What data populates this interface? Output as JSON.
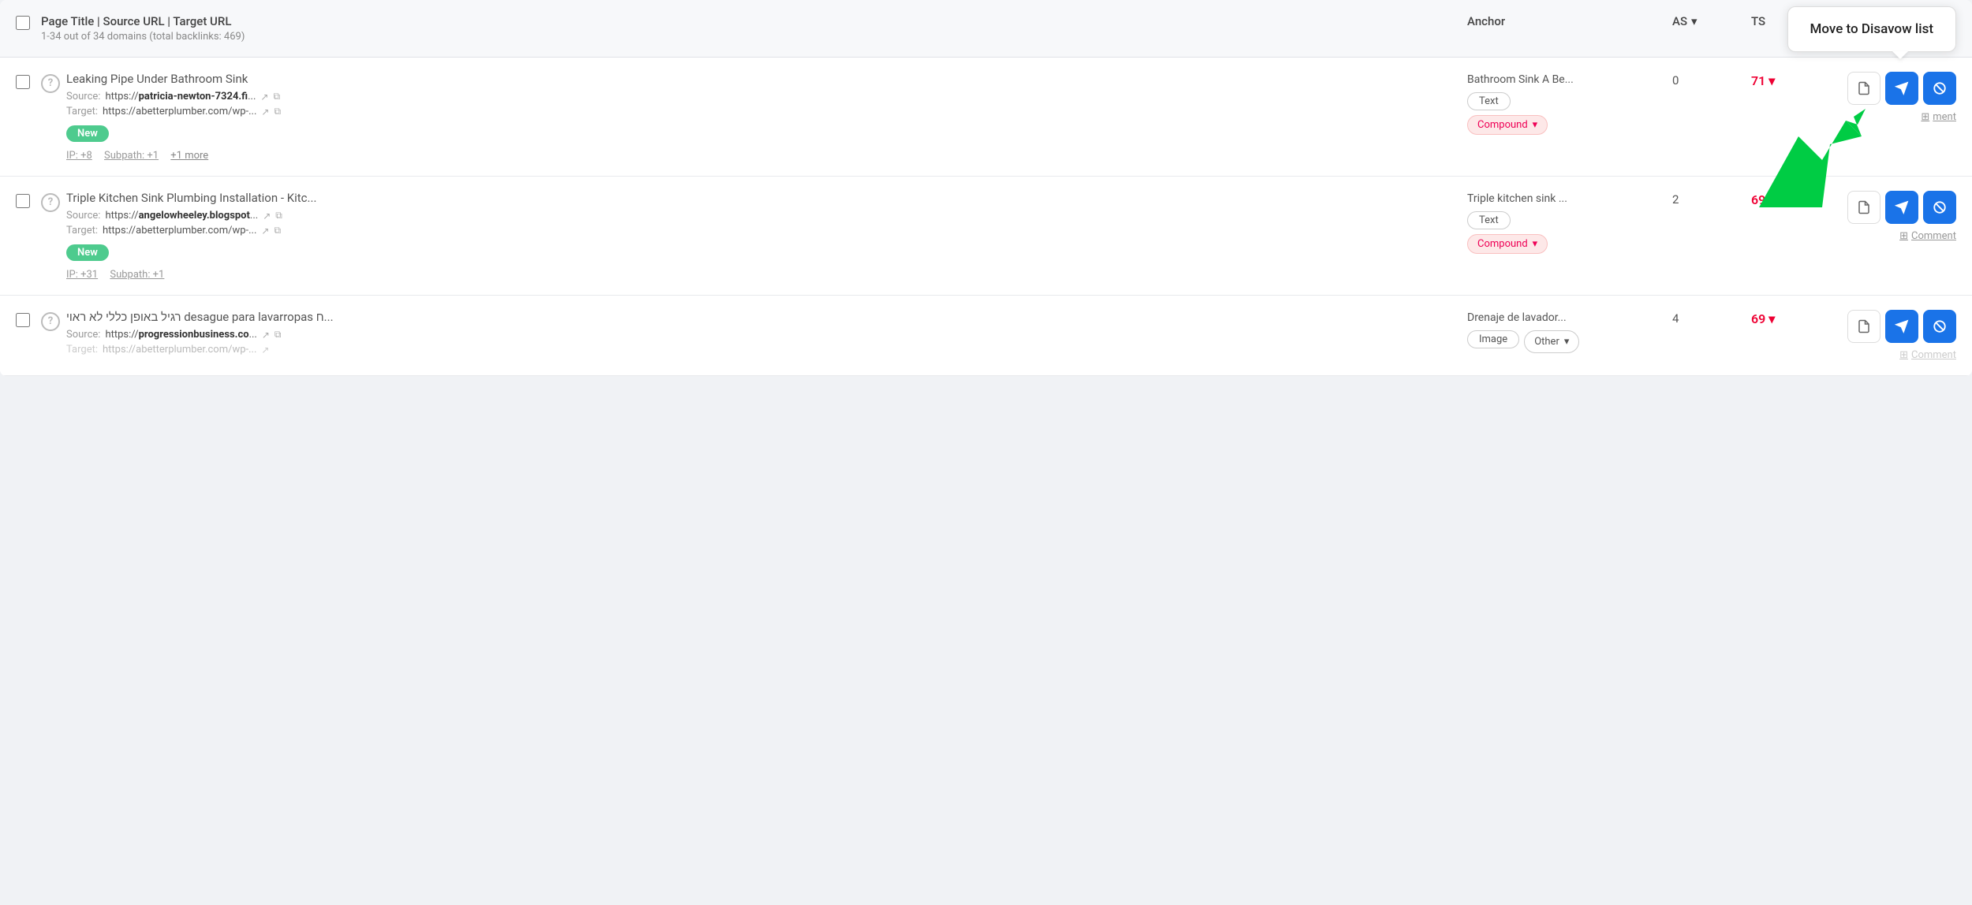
{
  "header": {
    "col_title": "Page Title | Source URL | Target URL",
    "col_subtitle": "1-34 out of 34 domains (total backlinks: 469)",
    "col_anchor": "Anchor",
    "col_as": "AS",
    "col_ts": "TS",
    "disavow_tooltip": "Move to Disavow list"
  },
  "rows": [
    {
      "id": "row1",
      "page_title": "Leaking Pipe Under Bathroom Sink",
      "source_label": "Source:",
      "source_url_plain": "https://",
      "source_url_bold": "patricia-newton-7324.fi",
      "source_url_end": "...",
      "target_label": "Target:",
      "target_url": "https://abetterplumber.com/wp-...",
      "is_new": true,
      "new_label": "New",
      "meta": "IP: +8   Subpath: +1   +1 more",
      "ip": "IP: +8",
      "subpath": "Subpath: +1",
      "more": "+1 more",
      "anchor_text": "Bathroom Sink A Be...",
      "anchor_type": "Text",
      "anchor_subtype": "Compound",
      "as_value": "0",
      "ts_value": "71",
      "ts_down": true,
      "has_comment": true,
      "comment_label": "ment"
    },
    {
      "id": "row2",
      "page_title": "Triple Kitchen Sink Plumbing Installation - Kitc...",
      "source_label": "Source:",
      "source_url_plain": "https://",
      "source_url_bold": "angelowheeley.blogspot",
      "source_url_end": "...",
      "target_label": "Target:",
      "target_url": "https://abetterplumber.com/wp-...",
      "is_new": true,
      "new_label": "New",
      "meta": "IP: +31   Subpath: +1",
      "ip": "IP: +31",
      "subpath": "Subpath: +1",
      "more": "",
      "anchor_text": "Triple kitchen sink ...",
      "anchor_type": "Text",
      "anchor_subtype": "Compound",
      "as_value": "2",
      "ts_value": "69",
      "ts_down": false,
      "has_comment": true,
      "comment_label": "Comment"
    },
    {
      "id": "row3",
      "page_title": "רגיל באופן כללי לא ראוי desague para lavarropas ח...",
      "source_label": "Source:",
      "source_url_plain": "https://",
      "source_url_bold": "progressionbusiness.co",
      "source_url_end": "...",
      "target_label": "Target:",
      "target_url": "https://abetterplumber.com/wp-...",
      "is_new": false,
      "new_label": "",
      "meta": "",
      "ip": "",
      "subpath": "",
      "more": "",
      "anchor_text": "Drenaje de lavador...",
      "anchor_type": "Image",
      "anchor_subtype": "Other",
      "as_value": "4",
      "ts_value": "69",
      "ts_down": true,
      "has_comment": true,
      "comment_label": "Comment"
    }
  ],
  "icons": {
    "external_link": "↗",
    "copy": "⧉",
    "info": "?",
    "document": "📄",
    "send": "✈",
    "block": "⊘",
    "comment_plus": "⊞",
    "chevron_down": "▾",
    "sort_down": "▾"
  }
}
